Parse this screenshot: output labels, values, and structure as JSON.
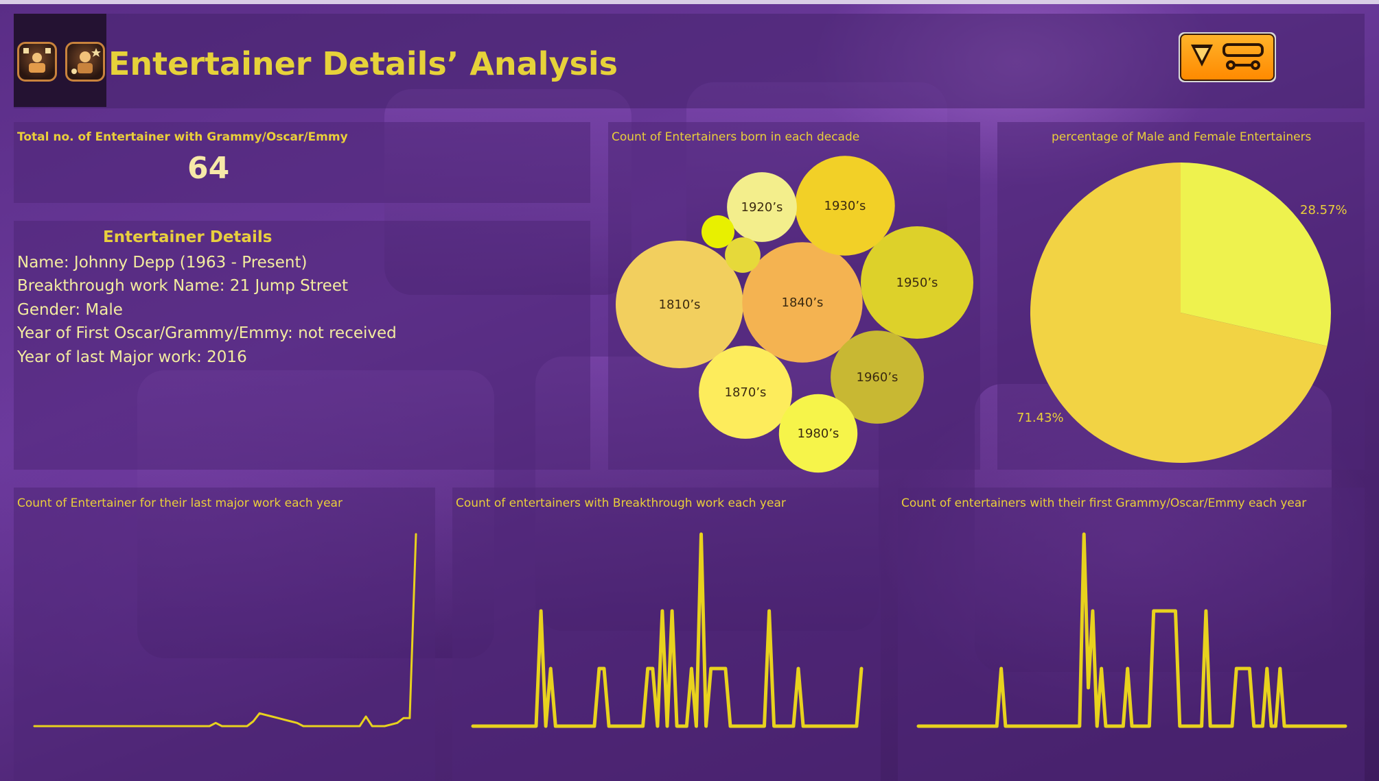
{
  "header": {
    "title": "Entertainer Details’ Analysis"
  },
  "kpi": {
    "label": "Total no. of Entertainer with Grammy/Oscar/Emmy",
    "value": "64"
  },
  "details": {
    "heading": "Entertainer Details",
    "lines": [
      "Name: Johnny Depp (1963 - Present)",
      "Breakthrough work Name: 21 Jump Street",
      "Gender: Male",
      "Year of First Oscar/Grammy/Emmy: not received",
      "Year of last Major work: 2016"
    ]
  },
  "colors": {
    "accent": "#e6d23a",
    "panel": "#4e2676",
    "line": "#e8d21e"
  },
  "chart_data": [
    {
      "type": "bubble",
      "title": "Count of Entertainers born in each decade",
      "bubbles": [
        {
          "label": "1810’s",
          "value": 9,
          "color": "#f2cf5e"
        },
        {
          "label": "1840’s",
          "value": 8,
          "color": "#f4b351"
        },
        {
          "label": "1950’s",
          "value": 7,
          "color": "#ddd12a"
        },
        {
          "label": "1930’s",
          "value": 5.5,
          "color": "#f2d027"
        },
        {
          "label": "1870’s",
          "value": 4.8,
          "color": "#fdec5c"
        },
        {
          "label": "1960’s",
          "value": 4.8,
          "color": "#c8b833"
        },
        {
          "label": "1980’s",
          "value": 3.4,
          "color": "#f6f44a"
        },
        {
          "label": "1920’s",
          "value": 2.7,
          "color": "#f3ee8c"
        },
        {
          "label": "",
          "value": 0.7,
          "color": "#e6d93a"
        },
        {
          "label": "",
          "value": 0.6,
          "color": "#e8f000"
        }
      ]
    },
    {
      "type": "pie",
      "title": "percentage of Male and Female Entertainers",
      "slices": [
        {
          "label": "28.57%",
          "value": 28.57,
          "color": "#eef24e"
        },
        {
          "label": "71.43%",
          "value": 71.43,
          "color": "#f2d344"
        }
      ]
    },
    {
      "type": "line",
      "title": "Count of Entertainer for their last major work each year",
      "values": [
        0,
        0,
        0,
        0,
        0,
        0,
        0,
        0,
        0,
        0,
        0,
        0,
        0,
        0,
        0,
        0,
        0,
        0,
        0,
        0,
        0,
        0,
        0,
        0,
        0,
        0,
        0,
        0,
        0,
        0.2,
        0,
        0,
        0,
        0,
        0,
        0.3,
        0.8,
        0.7,
        0.6,
        0.5,
        0.4,
        0.3,
        0.2,
        0,
        0,
        0,
        0,
        0,
        0,
        0,
        0,
        0,
        0,
        0.6,
        0,
        0,
        0,
        0.1,
        0.2,
        0.5,
        0.5,
        12
      ]
    },
    {
      "type": "line",
      "title": "Count of entertainers with Breakthrough work each year",
      "values": [
        0,
        0,
        0,
        0,
        0,
        0,
        0,
        0,
        0,
        0,
        0,
        0,
        0,
        0,
        3,
        0,
        1.5,
        0,
        0,
        0,
        0,
        0,
        0,
        0,
        0,
        0,
        1.5,
        1.5,
        0,
        0,
        0,
        0,
        0,
        0,
        0,
        0,
        1.5,
        1.5,
        0,
        3,
        0,
        3,
        0,
        0,
        0,
        1.5,
        0,
        5,
        0,
        1.5,
        1.5,
        1.5,
        1.5,
        0,
        0,
        0,
        0,
        0,
        0,
        0,
        0,
        3,
        0,
        0,
        0,
        0,
        0,
        1.5,
        0,
        0,
        0,
        0,
        0,
        0,
        0,
        0,
        0,
        0,
        0,
        0,
        1.5
      ]
    },
    {
      "type": "line",
      "title": "Count of entertainers with their first Grammy/Oscar/Emmy  each year",
      "values": [
        0,
        0,
        0,
        0,
        0,
        0,
        0,
        0,
        0,
        0,
        0,
        0,
        0,
        0,
        0,
        0,
        0,
        0,
        0,
        1.5,
        0,
        0,
        0,
        0,
        0,
        0,
        0,
        0,
        0,
        0,
        0,
        0,
        0,
        0,
        0,
        0,
        0,
        0,
        5,
        1,
        3,
        0,
        1.5,
        0,
        0,
        0,
        0,
        0,
        1.5,
        0,
        0,
        0,
        0,
        0,
        3,
        3,
        3,
        3,
        3,
        3,
        0,
        0,
        0,
        0,
        0,
        0,
        3,
        0,
        0,
        0,
        0,
        0,
        0,
        1.5,
        1.5,
        1.5,
        1.5,
        0,
        0,
        0,
        1.5,
        0,
        0,
        1.5,
        0,
        0,
        0,
        0,
        0,
        0,
        0,
        0,
        0,
        0,
        0,
        0,
        0,
        0,
        0
      ]
    }
  ]
}
